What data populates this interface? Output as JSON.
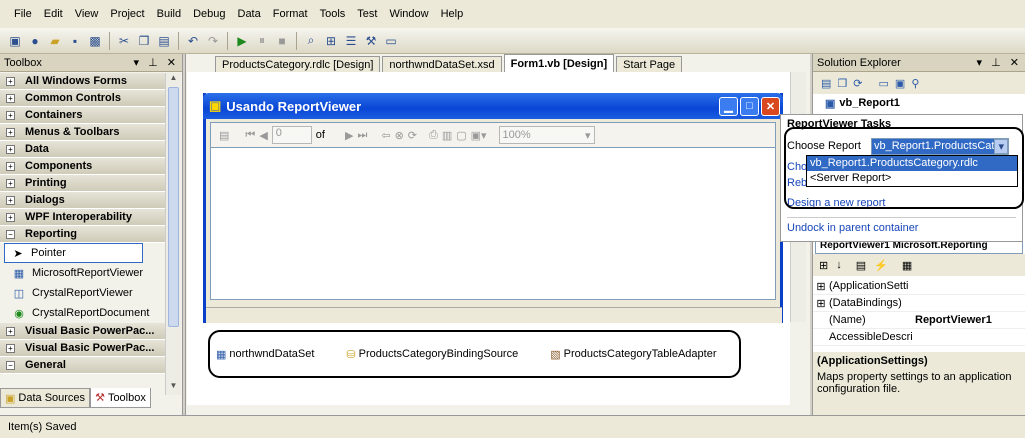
{
  "menu": [
    "File",
    "Edit",
    "View",
    "Project",
    "Build",
    "Debug",
    "Data",
    "Format",
    "Tools",
    "Test",
    "Window",
    "Help"
  ],
  "toolbox": {
    "title": "Toolbox",
    "categories": [
      {
        "label": "All Windows Forms",
        "expanded": false
      },
      {
        "label": "Common Controls",
        "expanded": false
      },
      {
        "label": "Containers",
        "expanded": false
      },
      {
        "label": "Menus & Toolbars",
        "expanded": false
      },
      {
        "label": "Data",
        "expanded": false
      },
      {
        "label": "Components",
        "expanded": false
      },
      {
        "label": "Printing",
        "expanded": false
      },
      {
        "label": "Dialogs",
        "expanded": false
      },
      {
        "label": "WPF Interoperability",
        "expanded": false
      },
      {
        "label": "Reporting",
        "expanded": true
      }
    ],
    "reporting_items": [
      "Pointer",
      "MicrosoftReportViewer",
      "CrystalReportViewer",
      "CrystalReportDocument"
    ],
    "more_categories": [
      "Visual Basic PowerPac...",
      "Visual Basic PowerPac...",
      "General"
    ],
    "bottom_tabs": [
      "Data Sources",
      "Toolbox"
    ]
  },
  "doc_tabs": [
    "ProductsCategory.rdlc [Design]",
    "northwndDataSet.xsd",
    "Form1.vb [Design]",
    "Start Page"
  ],
  "form": {
    "title": "Usando ReportViewer",
    "page_value": "0",
    "of_label": "of",
    "zoom": "100%"
  },
  "tray": [
    "northwndDataSet",
    "ProductsCategoryBindingSource",
    "ProductsCategoryTableAdapter"
  ],
  "solution_explorer": {
    "title": "Solution Explorer",
    "project": "vb_Report1"
  },
  "tasks": {
    "title": "ReportViewer Tasks",
    "choose_label": "Choose Report",
    "choose_value": "vb_Report1.ProductsCat",
    "options": [
      "vb_Report1.ProductsCategory.rdlc",
      "<Server Report>"
    ],
    "links": [
      "Rebind Data Sources",
      "Design a new report",
      "Undock in parent container"
    ],
    "partial": "Choo"
  },
  "properties": {
    "header": "ReportViewer1  Microsoft.Reporting",
    "rows": [
      {
        "name": "(ApplicationSetti",
        "value": "",
        "expandable": true
      },
      {
        "name": "(DataBindings)",
        "value": "",
        "expandable": true
      },
      {
        "name": "(Name)",
        "value": "ReportViewer1",
        "expandable": false
      },
      {
        "name": "AccessibleDescri",
        "value": "",
        "expandable": false
      }
    ],
    "desc_title": "(ApplicationSettings)",
    "desc_text": "Maps property settings to an application configuration file."
  },
  "status": "Item(s) Saved"
}
